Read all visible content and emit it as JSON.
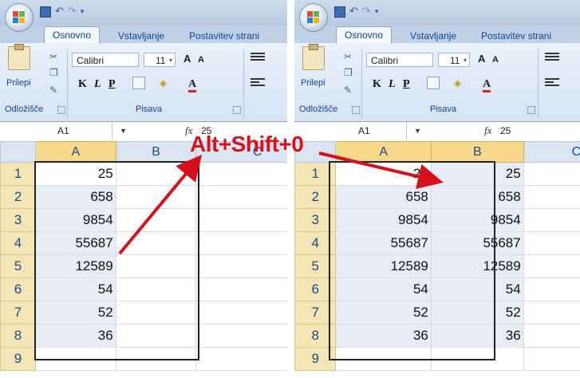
{
  "ribbon": {
    "tabs": [
      "Osnovno",
      "Vstavljanje",
      "Postavitev strani"
    ],
    "paste_label": "Prilepi",
    "clipboard_group": "Odložišče",
    "font_group": "Pisava",
    "font_name": "Calibri",
    "font_size": "11",
    "grow_font": "A",
    "shrink_font": "A",
    "bold": "K",
    "italic": "L",
    "underline": "P",
    "font_color": "A"
  },
  "formula_bar": {
    "name_box": "A1",
    "fx": "fx",
    "value": "25"
  },
  "grid": {
    "columns": [
      "A",
      "B",
      "C"
    ],
    "row_numbers": [
      "1",
      "2",
      "3",
      "4",
      "5",
      "6",
      "7",
      "8",
      "9"
    ]
  },
  "left": {
    "col_a": [
      "25",
      "658",
      "9854",
      "55687",
      "12589",
      "54",
      "52",
      "36",
      ""
    ],
    "col_b": [
      "",
      "",
      "",
      "",
      "",
      "",
      "",
      "",
      ""
    ]
  },
  "right": {
    "col_a": [
      "25",
      "658",
      "9854",
      "55687",
      "12589",
      "54",
      "52",
      "36",
      ""
    ],
    "col_b": [
      "25",
      "658",
      "9854",
      "55687",
      "12589",
      "54",
      "52",
      "36",
      ""
    ]
  },
  "annotation": {
    "shortcut": "Alt+Shift+0",
    "arrow_color": "#d6111c"
  },
  "colors": {
    "row_header": "#f4e5b4",
    "col_header": "#dbe5f1",
    "selected_col_header": "#f6d98a",
    "ribbon": "#d5e3f3"
  }
}
